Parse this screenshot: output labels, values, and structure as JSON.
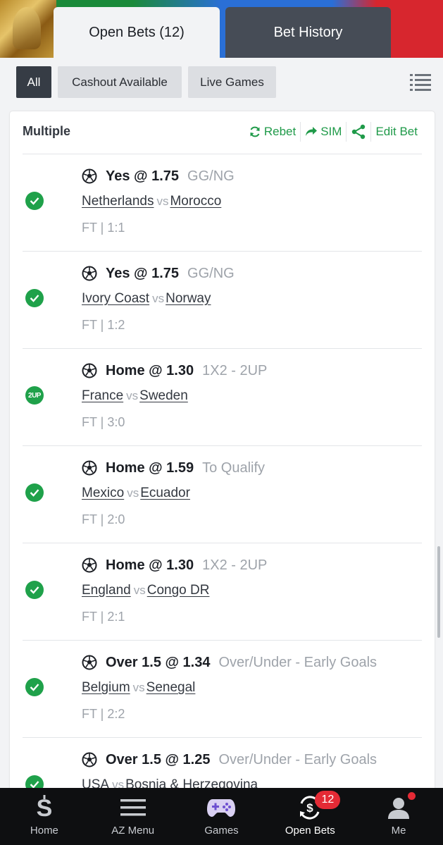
{
  "tabs": {
    "open_bets": "Open Bets (12)",
    "bet_history": "Bet History"
  },
  "filters": {
    "all": "All",
    "cashout": "Cashout Available",
    "live": "Live Games"
  },
  "card": {
    "title": "Multiple",
    "actions": {
      "rebet": "Rebet",
      "sim": "SIM",
      "edit_bet": "Edit Bet"
    },
    "accent_color": "#1f9a49"
  },
  "selections": [
    {
      "pick": "Yes @ 1.75",
      "market": "GG/NG",
      "home": "Netherlands",
      "vs": "vs",
      "away": "Morocco",
      "result": "FT | 1:1",
      "status": "won"
    },
    {
      "pick": "Yes @ 1.75",
      "market": "GG/NG",
      "home": "Ivory Coast",
      "vs": "vs",
      "away": "Norway",
      "result": "FT | 1:2",
      "status": "won"
    },
    {
      "pick": "Home @ 1.30",
      "market": "1X2  -  2UP",
      "home": "France",
      "vs": "vs",
      "away": "Sweden",
      "result": "FT | 3:0",
      "status": "2up",
      "status_text": "2UP"
    },
    {
      "pick": "Home @ 1.59",
      "market": "To Qualify",
      "home": "Mexico",
      "vs": "vs",
      "away": "Ecuador",
      "result": "FT | 2:0",
      "status": "won"
    },
    {
      "pick": "Home @ 1.30",
      "market": "1X2  -  2UP",
      "home": "England",
      "vs": "vs",
      "away": "Congo DR",
      "result": "FT | 2:1",
      "status": "won"
    },
    {
      "pick": "Over 1.5 @ 1.34",
      "market": "Over/Under  -  Early Goals",
      "home": "Belgium",
      "vs": "vs",
      "away": "Senegal",
      "result": "FT | 2:2",
      "status": "won"
    },
    {
      "pick": "Over 1.5 @ 1.25",
      "market": "Over/Under  -  Early Goals",
      "home": "USA",
      "vs": "vs",
      "away": "Bosnia & Herzegovina",
      "result": "",
      "status": "won"
    }
  ],
  "bottom_nav": {
    "home": "Home",
    "az_menu": "AZ Menu",
    "games": "Games",
    "open_bets": "Open Bets",
    "open_bets_badge": "12",
    "me": "Me"
  }
}
